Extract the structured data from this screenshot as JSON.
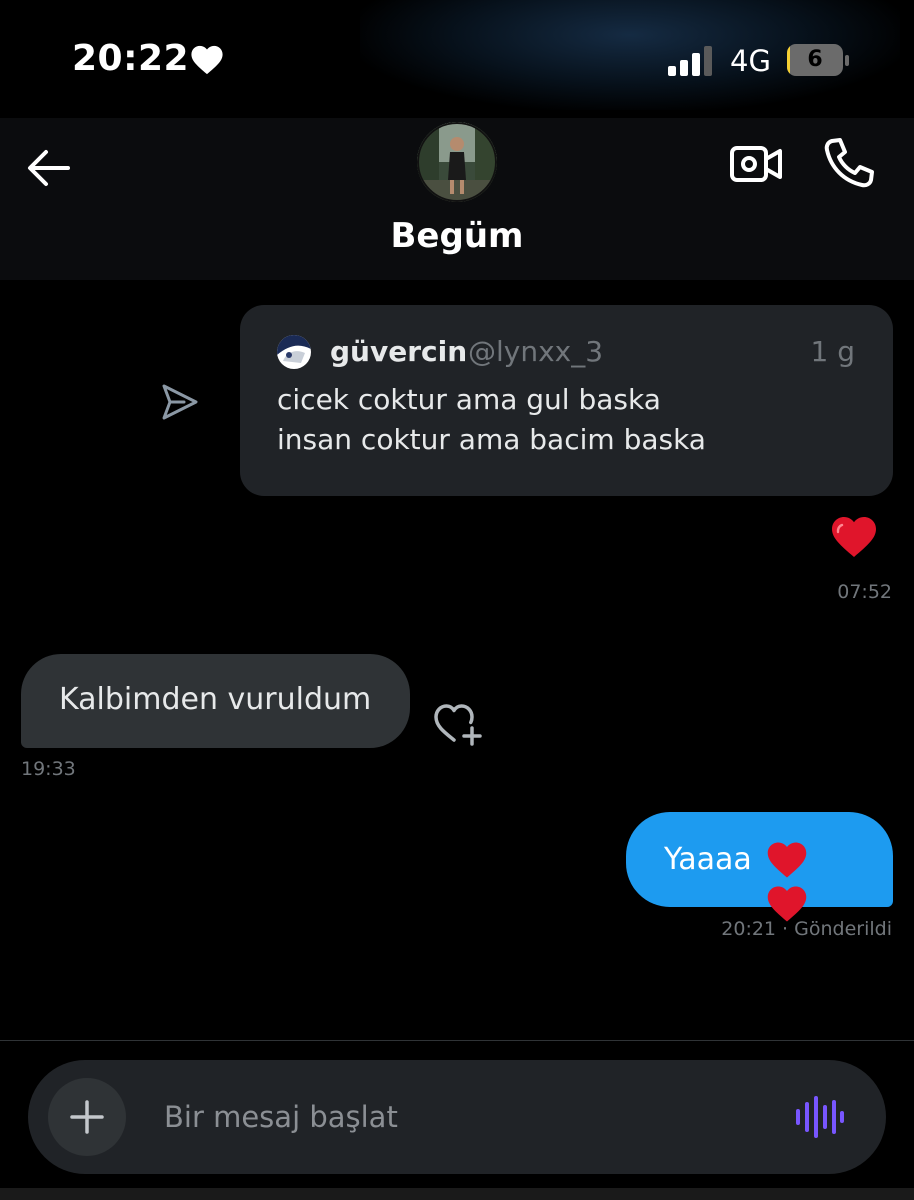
{
  "status_bar": {
    "time": "20:22",
    "network": "4G",
    "battery_level": "6",
    "battery_fraction": 0.06,
    "accent_heart_color": "#ffffff"
  },
  "header": {
    "contact_name": "Begüm",
    "icons": [
      "arrow-left-icon",
      "video-camera-icon",
      "phone-icon"
    ]
  },
  "conversation": {
    "shared_tweet": {
      "author_name": "güvercin",
      "author_handle": "@lynxx_3",
      "age": "1 g",
      "lines": [
        "cicek coktur ama gul baska",
        "insan coktur ama bacim baska"
      ]
    },
    "shared_timestamp": "07:52",
    "received": {
      "text": "Kalbimden vuruldum",
      "timestamp": "19:33"
    },
    "sent": {
      "text": "Yaaaa",
      "timestamp": "20:21 · Gönderildi"
    },
    "colors": {
      "sent_bubble": "#1d9bf0",
      "received_bubble": "#2f3336",
      "heart": "#e0152b"
    }
  },
  "composer": {
    "placeholder": "Bir mesaj başlat"
  }
}
